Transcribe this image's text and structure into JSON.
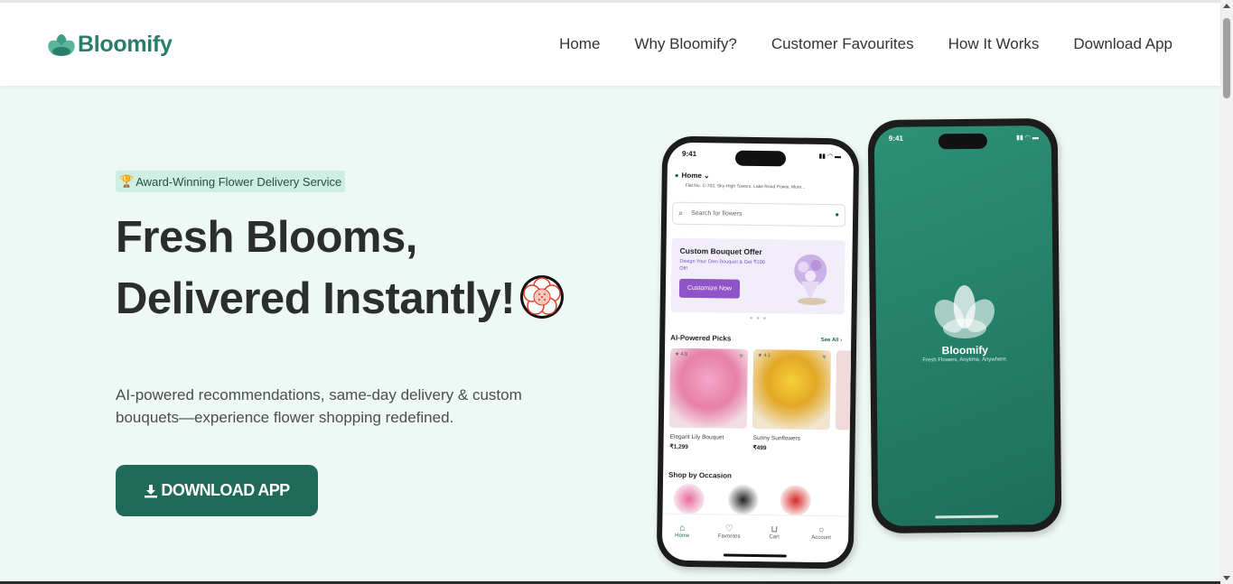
{
  "brand": {
    "name": "Bloomify",
    "color": "#2a7d68"
  },
  "nav": {
    "items": [
      "Home",
      "Why Bloomify?",
      "Customer Favourites",
      "How It Works",
      "Download App"
    ]
  },
  "hero": {
    "badge_icon": "trophy-icon",
    "badge": "Award-Winning Flower Delivery Service",
    "title_line1": "Fresh Blooms,",
    "title_line2": "Delivered Instantly!",
    "title_icon": "flower-emoji-icon",
    "description": "AI-powered recommendations, same-day delivery & custom bouquets—experience flower shopping redefined.",
    "cta": "DOWNLOAD APP",
    "cta_color": "#1f6a58",
    "background": "#eef8f5"
  },
  "phone_app": {
    "time": "9:41",
    "location_label": "Home",
    "address": "Flat No. C-702, Sky-High Towers, Lake Road Powai, Mum...",
    "search_placeholder": "Search for flowers",
    "banner": {
      "title": "Custom Bouquet Offer",
      "subtitle": "Design Your Own Bouquet & Get ₹100 Off!",
      "button": "Customize Now"
    },
    "ai_section": "AI-Powered Picks",
    "see_all": "See All",
    "products": [
      {
        "name": "Elegant Lily Bouquet",
        "price": "₹1,299",
        "rating": "4.8"
      },
      {
        "name": "Sunny Sunflowers",
        "price": "₹499",
        "rating": "4.1"
      }
    ],
    "occasion_section": "Shop by Occasion",
    "tabs": [
      "Home",
      "Favorites",
      "Cart",
      "Account"
    ]
  },
  "phone_splash": {
    "time": "9:41",
    "name": "Bloomify",
    "tagline": "Fresh Flowers, Anytime, Anywhere."
  }
}
